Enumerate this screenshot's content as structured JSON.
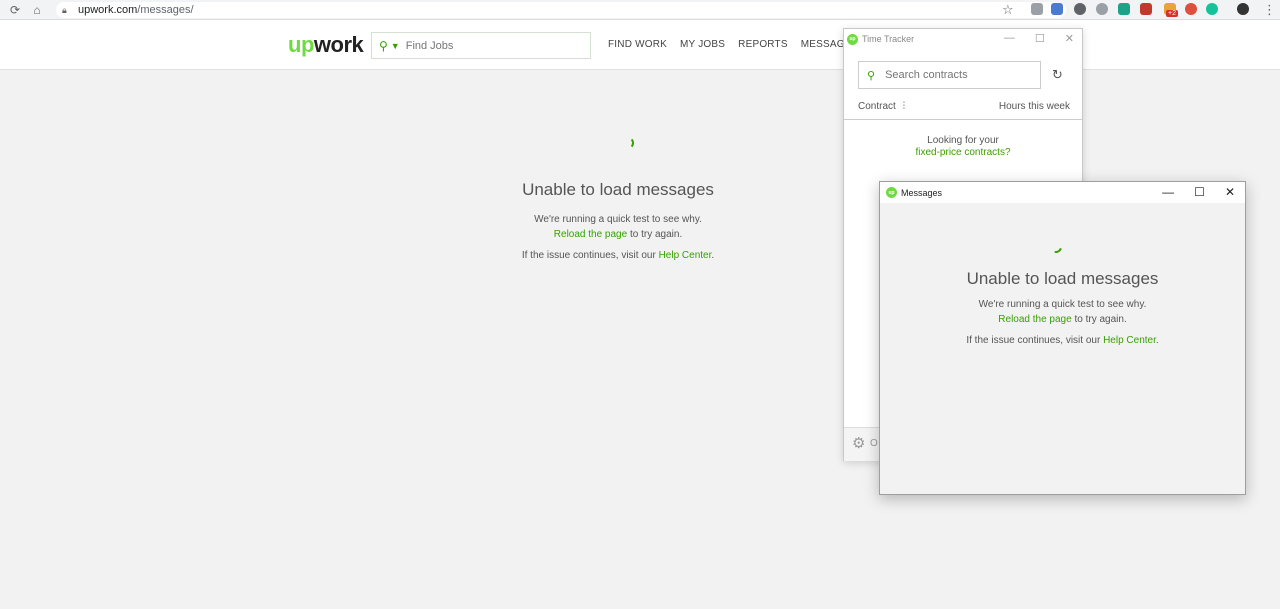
{
  "browser": {
    "url_host": "upwork.com",
    "url_path": "/messages/",
    "extensions": [
      {
        "name": "shield-icon",
        "color": "#9aa0a6"
      },
      {
        "name": "translate-icon",
        "color": "#4a7bd0"
      },
      {
        "name": "bulb-icon",
        "color": "#5f6368"
      },
      {
        "name": "globe-icon",
        "color": "#9aa0a6"
      },
      {
        "name": "note-icon",
        "color": "#1aa387"
      },
      {
        "name": "gift-icon",
        "color": "#c0392b"
      },
      {
        "name": "mail-icon",
        "color": "#e8a33a"
      },
      {
        "name": "chrome-icon",
        "color": "#de4f40"
      },
      {
        "name": "grammarly-icon",
        "color": "#15c39a"
      }
    ],
    "badge": "+2"
  },
  "header": {
    "logo_up": "up",
    "logo_work": "work",
    "search_placeholder": "Find Jobs",
    "nav": [
      "FIND WORK",
      "MY JOBS",
      "REPORTS",
      "MESSAGES"
    ]
  },
  "main": {
    "title": "Unable to load messages",
    "line1": "We're running a quick test to see why.",
    "reload_link": "Reload the page",
    "reload_suffix": " to try again.",
    "help_prefix": "If the issue continues, visit our ",
    "help_link": "Help Center",
    "help_suffix": "."
  },
  "time_tracker": {
    "title": "Time Tracker",
    "search_placeholder": "Search contracts",
    "col_contract": "Contract",
    "col_hours": "Hours this week",
    "hint_line1": "Looking for your",
    "hint_link": "fixed-price contracts?",
    "footer_label": "O"
  },
  "messages_window": {
    "title": "Messages",
    "error_title": "Unable to load messages",
    "line1": "We're running a quick test to see why.",
    "reload_link": "Reload the page",
    "reload_suffix": " to try again.",
    "help_prefix": "If the issue continues, visit our ",
    "help_link": "Help Center",
    "help_suffix": "."
  },
  "colors": {
    "brand_green": "#6fda44",
    "link_green": "#37a000"
  }
}
